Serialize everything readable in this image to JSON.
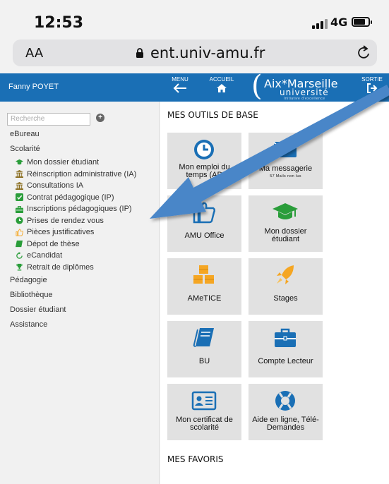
{
  "status_bar": {
    "time": "12:53",
    "network": "4G"
  },
  "browser": {
    "text_size": "AA",
    "url": "ent.univ-amu.fr"
  },
  "header": {
    "user_name": "Fanny POYET",
    "menu_label": "MENU",
    "home_label": "ACCUEIL",
    "logout_label": "SORTIE",
    "logo_line1": "Aix*Marseille",
    "logo_line2": "université",
    "logo_line3": "Initiative d'excellence"
  },
  "sidebar": {
    "search_placeholder": "Recherche",
    "items": {
      "ebureau": "eBureau",
      "scolarite": "Scolarité",
      "pedagogie": "Pédagogie",
      "bibliotheque": "Bibliothèque",
      "dossier_etudiant": "Dossier étudiant",
      "assistance": "Assistance"
    },
    "scolarite_sub": [
      "Mon dossier étudiant",
      "Réinscription administrative (IA)",
      "Consultations IA",
      "Contrat pédagogique (IP)",
      "Inscriptions pédagogiques (IP)",
      "Prises de rendez vous",
      "Pièces justificatives",
      "Dépot de thèse",
      "eCandidat",
      "Retrait de diplômes"
    ]
  },
  "main": {
    "tools_title": "MES OUTILS DE BASE",
    "favorites_title": "MES FAVORIS",
    "tiles": [
      {
        "label": "Mon emploi du temps (AD",
        "icon": "clock-icon"
      },
      {
        "label": "Ma messagerie",
        "sub": "57 Mails non lus",
        "icon": "mail-icon"
      },
      {
        "label": "AMU Office",
        "icon": "thumbs-up-icon"
      },
      {
        "label": "Mon dossier étudiant",
        "icon": "graduation-cap-icon"
      },
      {
        "label": "AMeTICE",
        "icon": "cubes-icon"
      },
      {
        "label": "Stages",
        "icon": "rocket-icon"
      },
      {
        "label": "BU",
        "icon": "book-icon"
      },
      {
        "label": "Compte Lecteur",
        "icon": "briefcase-icon"
      },
      {
        "label": "Mon certificat de scolarité",
        "icon": "id-card-icon"
      },
      {
        "label": "Aide en ligne, Télé-Demandes",
        "icon": "lifebuoy-icon"
      }
    ]
  },
  "colors": {
    "header_blue": "#1a6fb5",
    "icon_blue": "#1a6fb5",
    "icon_orange": "#f5a623",
    "icon_green": "#2a9d3a",
    "arrow_blue": "#4a86c8"
  }
}
